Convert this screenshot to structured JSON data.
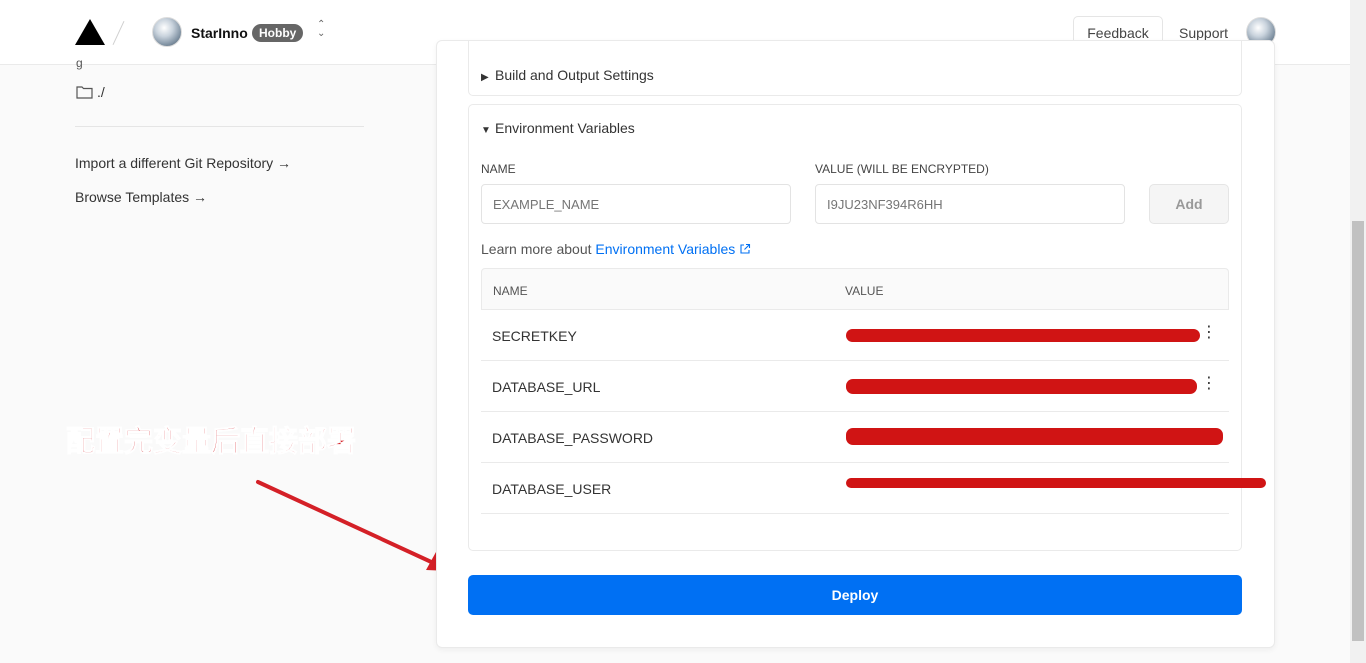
{
  "header": {
    "team_name": "StarInno",
    "plan_badge": "Hobby",
    "feedback_label": "Feedback",
    "support_label": "Support"
  },
  "sidebar": {
    "dir_stub": "g",
    "directory": "./",
    "import_link": "Import a different Git Repository →",
    "templates_link": "Browse Templates →"
  },
  "annotation": {
    "text": "配置完变量后直接部署",
    "color": "#d42027"
  },
  "build_section": {
    "title": "Build and Output Settings",
    "collapsed": true
  },
  "env_section": {
    "title": "Environment Variables",
    "name_label": "NAME",
    "value_label": "VALUE (WILL BE ENCRYPTED)",
    "name_placeholder": "EXAMPLE_NAME",
    "value_placeholder": "I9JU23NF394R6HH",
    "add_label": "Add",
    "learn_more_prefix": "Learn more about",
    "learn_more_link": "Environment Variables",
    "table": {
      "headers": [
        "NAME",
        "VALUE"
      ],
      "rows": [
        {
          "name": "SECRETKEY",
          "value": "redacted"
        },
        {
          "name": "DATABASE_URL",
          "value": "redacted"
        },
        {
          "name": "DATABASE_PASSWORD",
          "value": "redacted"
        },
        {
          "name": "DATABASE_USER",
          "value": "redacted"
        }
      ]
    }
  },
  "deploy_label": "Deploy",
  "colors": {
    "accent": "#0070f3",
    "redaction": "#d01414"
  }
}
